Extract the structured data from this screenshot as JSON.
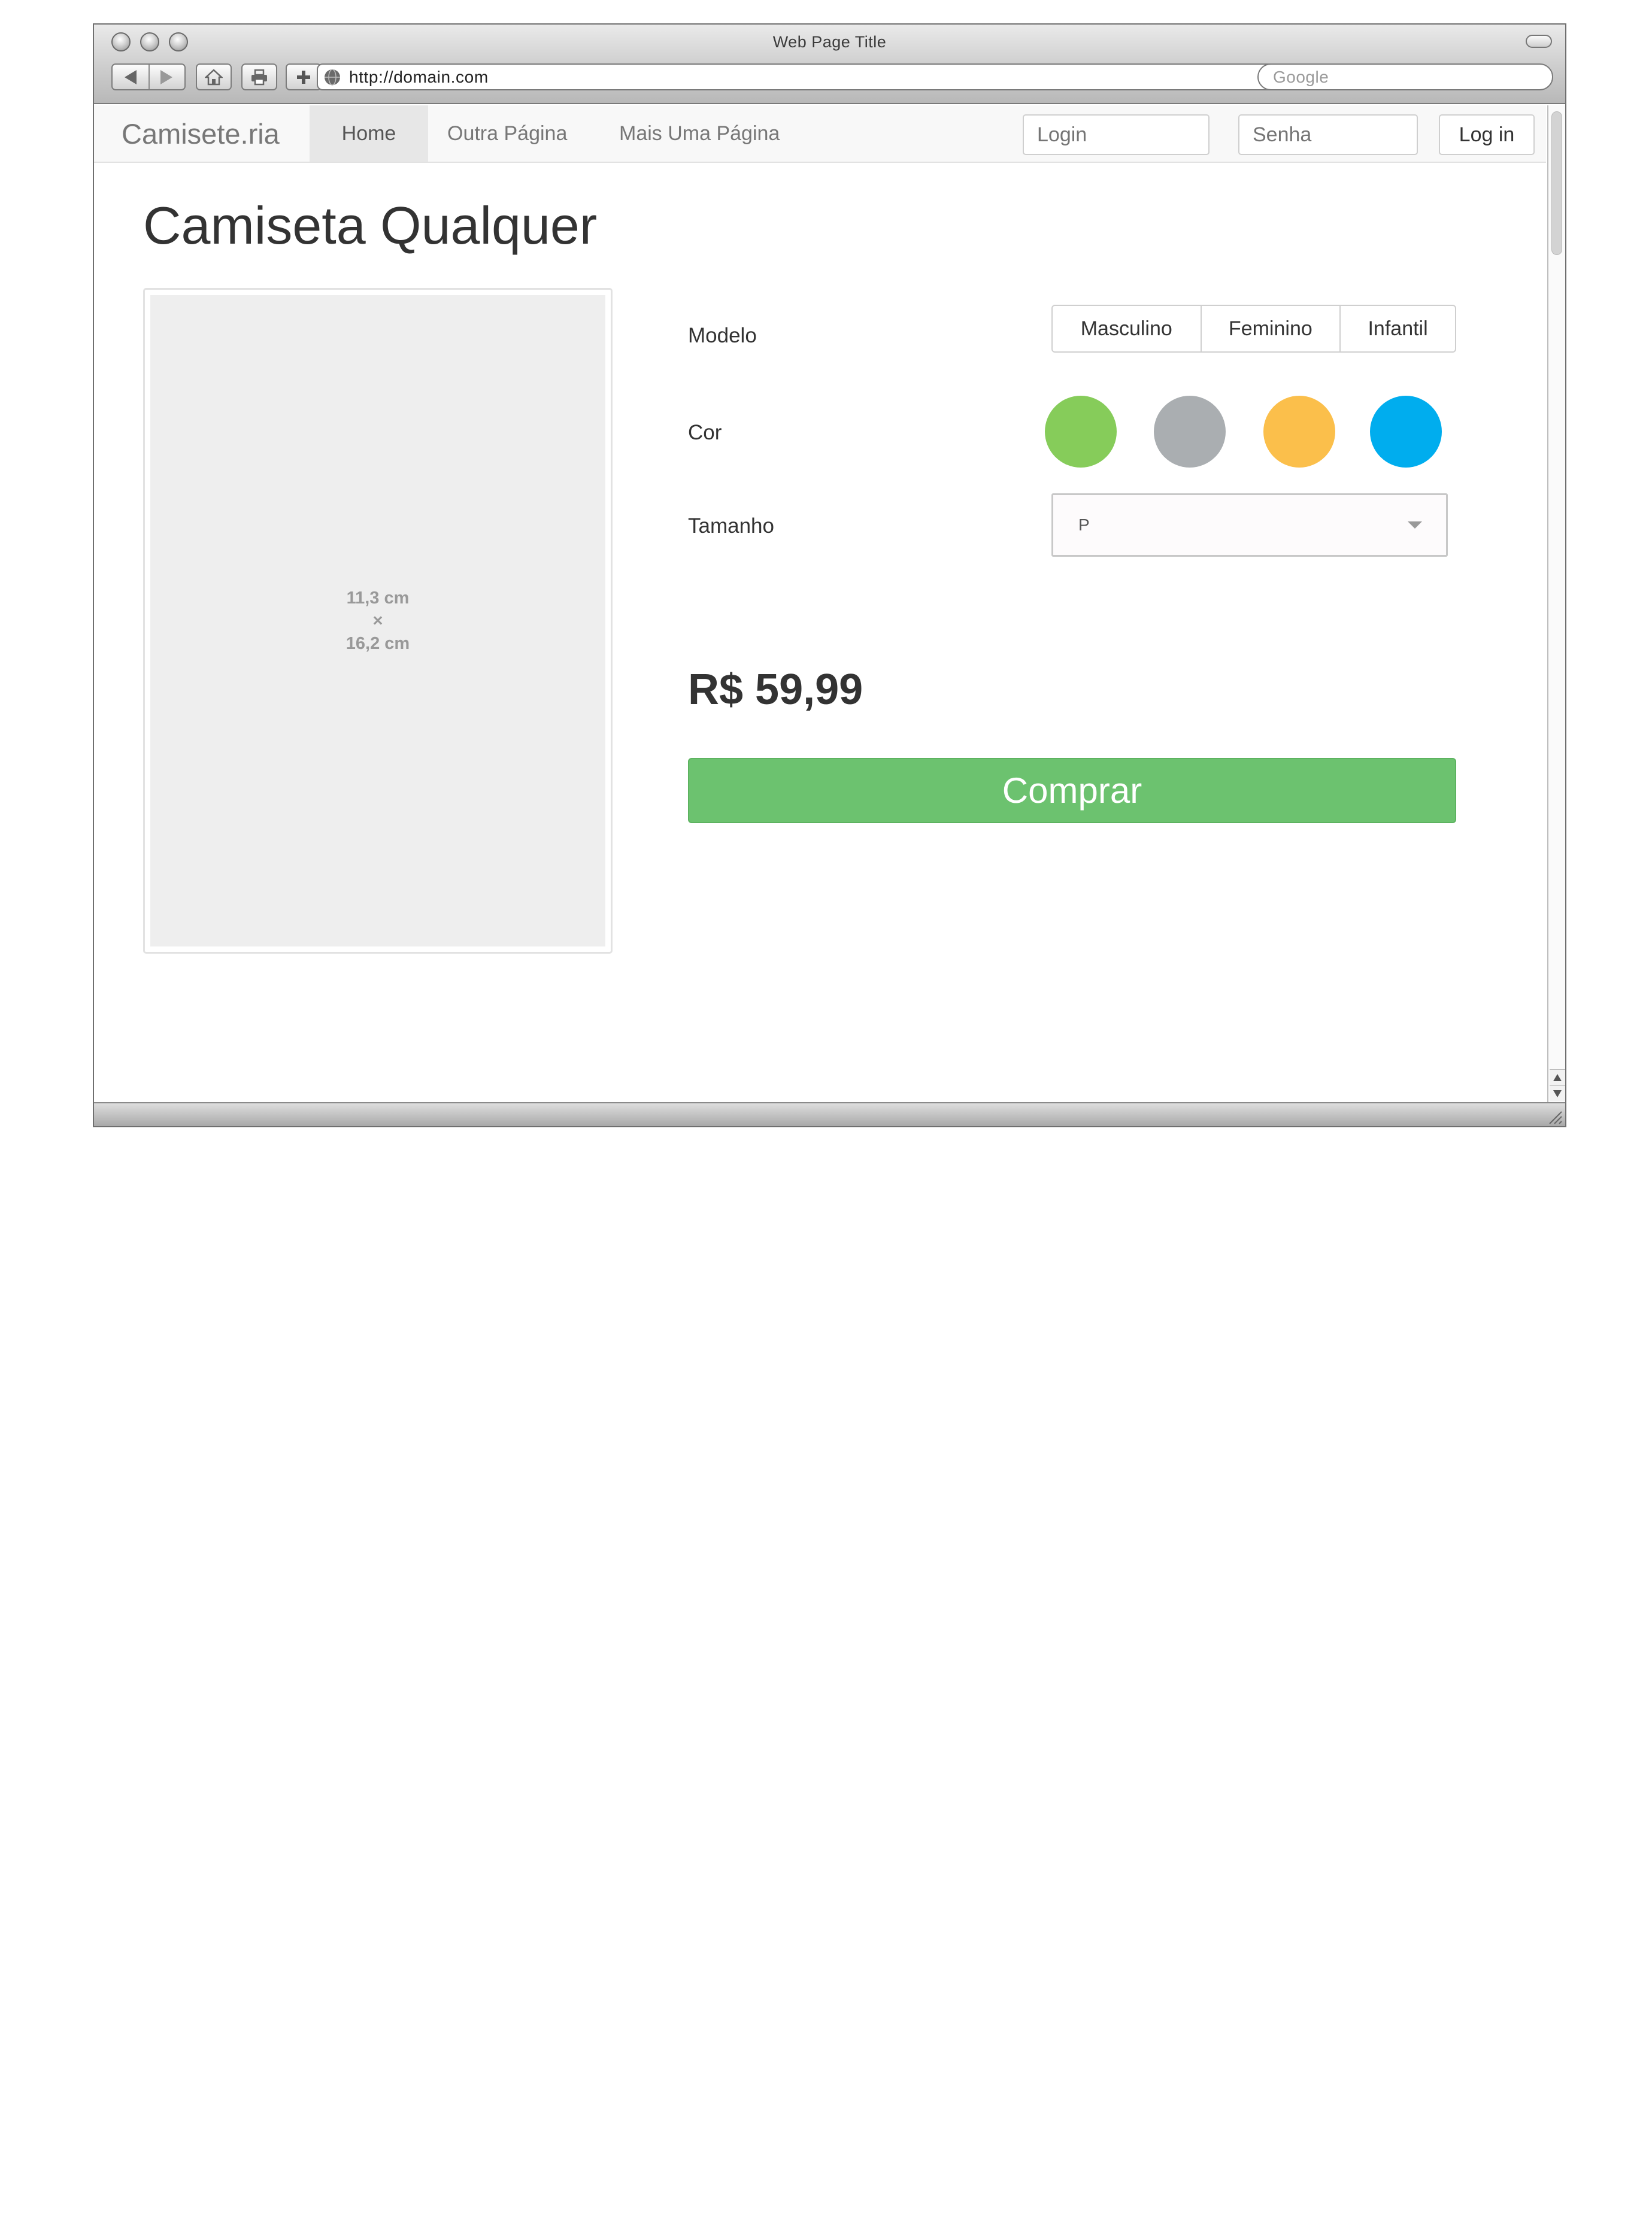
{
  "window": {
    "title": "Web Page Title"
  },
  "toolbar": {
    "url": "http://domain.com",
    "search_placeholder": "Google"
  },
  "navbar": {
    "brand": "Camisete.ria",
    "items": [
      {
        "label": "Home",
        "active": true
      },
      {
        "label": "Outra Página",
        "active": false
      },
      {
        "label": "Mais Uma Página",
        "active": false
      }
    ],
    "login_placeholder": "Login",
    "password_placeholder": "Senha",
    "login_button": "Log in"
  },
  "product": {
    "title": "Camiseta Qualquer",
    "image_placeholder": {
      "width": "11,3 cm",
      "separator": "×",
      "height": "16,2 cm"
    },
    "options": {
      "modelo_label": "Modelo",
      "modelo_choices": [
        "Masculino",
        "Feminino",
        "Infantil"
      ],
      "cor_label": "Cor",
      "colors": [
        "#86cc5a",
        "#aaaeb1",
        "#fbbf4b",
        "#00adee"
      ],
      "tamanho_label": "Tamanho",
      "tamanho_selected": "P"
    },
    "price": "R$ 59,99",
    "buy_button": "Comprar"
  }
}
